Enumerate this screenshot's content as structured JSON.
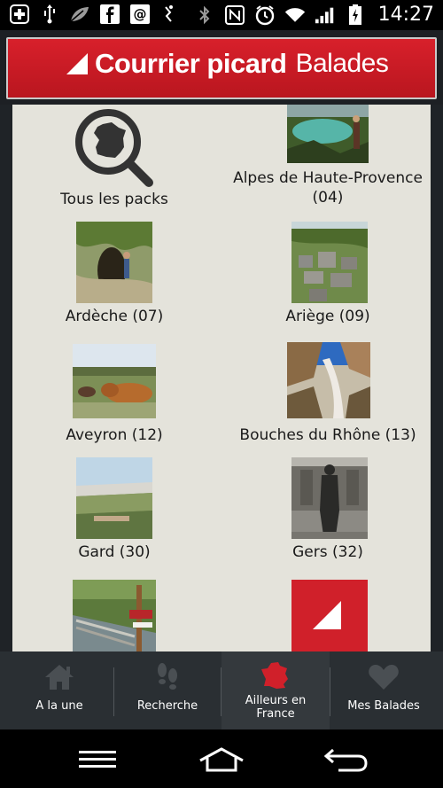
{
  "status_bar": {
    "time": "14:27",
    "left_icons": [
      "plus-icon",
      "usb-icon",
      "leaf-icon",
      "facebook-icon",
      "email-icon",
      "hand-icon"
    ],
    "right_icons": [
      "bluetooth-icon",
      "nfc-icon",
      "alarm-icon",
      "wifi-icon",
      "signal-icon",
      "battery-icon"
    ]
  },
  "app": {
    "brand_name": "Courrier picard",
    "brand_sub": "Balades",
    "brand_color": "#d0202a"
  },
  "packs": [
    {
      "label": "Tous les packs",
      "kind": "search-france-icon"
    },
    {
      "label": "Alpes de Haute-Provence (04)",
      "kind": "photo"
    },
    {
      "label": "Ardèche (07)",
      "kind": "photo"
    },
    {
      "label": "Ariège (09)",
      "kind": "photo"
    },
    {
      "label": "Aveyron (12)",
      "kind": "photo"
    },
    {
      "label": "Bouches du Rhône (13)",
      "kind": "photo"
    },
    {
      "label": "Gard (30)",
      "kind": "photo"
    },
    {
      "label": "Gers (32)",
      "kind": "photo"
    },
    {
      "label": "",
      "kind": "photo"
    },
    {
      "label": "",
      "kind": "logo"
    }
  ],
  "tabs": [
    {
      "label": "A la une",
      "icon": "home-icon",
      "active": false
    },
    {
      "label": "Recherche",
      "icon": "footsteps-icon",
      "active": false
    },
    {
      "label": "Ailleurs en France",
      "icon": "france-map-icon",
      "active": true
    },
    {
      "label": "Mes Balades",
      "icon": "heart-icon",
      "active": false
    }
  ],
  "android_nav": [
    "menu-icon",
    "home-icon",
    "back-icon"
  ]
}
